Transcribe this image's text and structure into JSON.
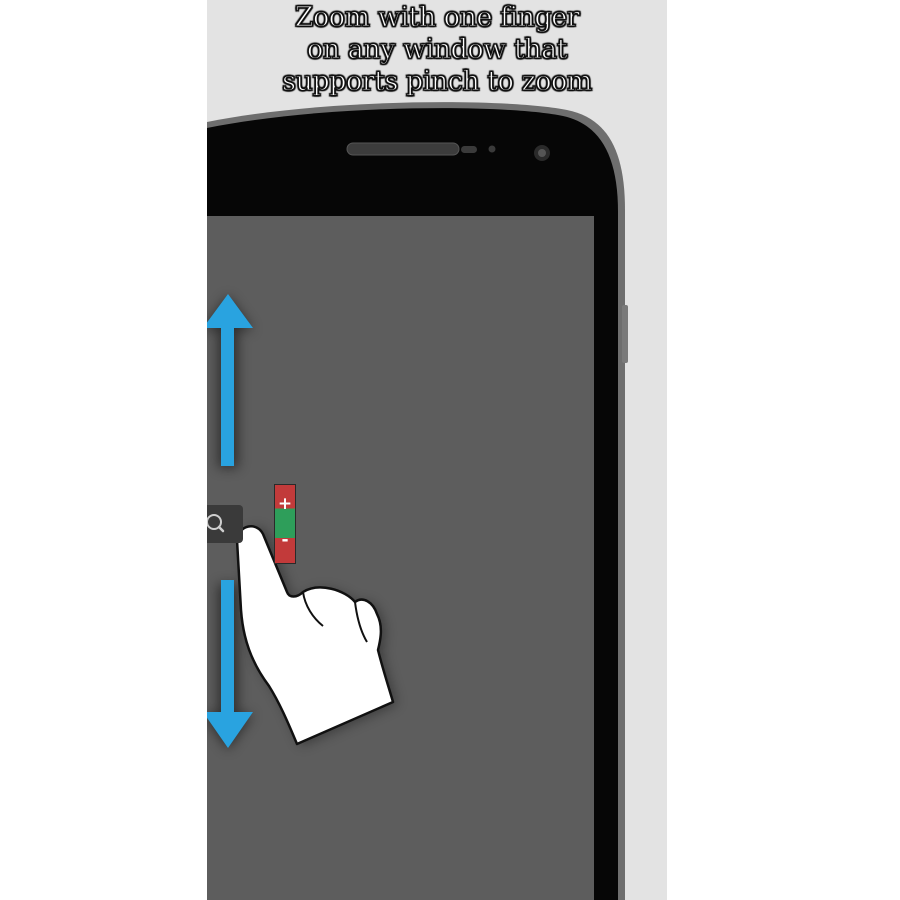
{
  "caption": {
    "line1": "Zoom with one finger",
    "line2": "on any window that",
    "line3": "supports pinch to zoom"
  },
  "zoom_control": {
    "plus_symbol": "+",
    "minus_symbol": "-",
    "search_icon": "magnifier-icon"
  },
  "icons": {
    "up_arrow": "arrow-up-icon",
    "down_arrow": "arrow-down-icon",
    "hand": "pointing-hand-icon"
  },
  "colors": {
    "background": "#e3e3e3",
    "screen": "#5d5d5d",
    "phone_body": "#050505",
    "arrow": "#29a3e0",
    "zoom_plus": "#c23a3a",
    "zoom_middle": "#2e9e5a"
  }
}
